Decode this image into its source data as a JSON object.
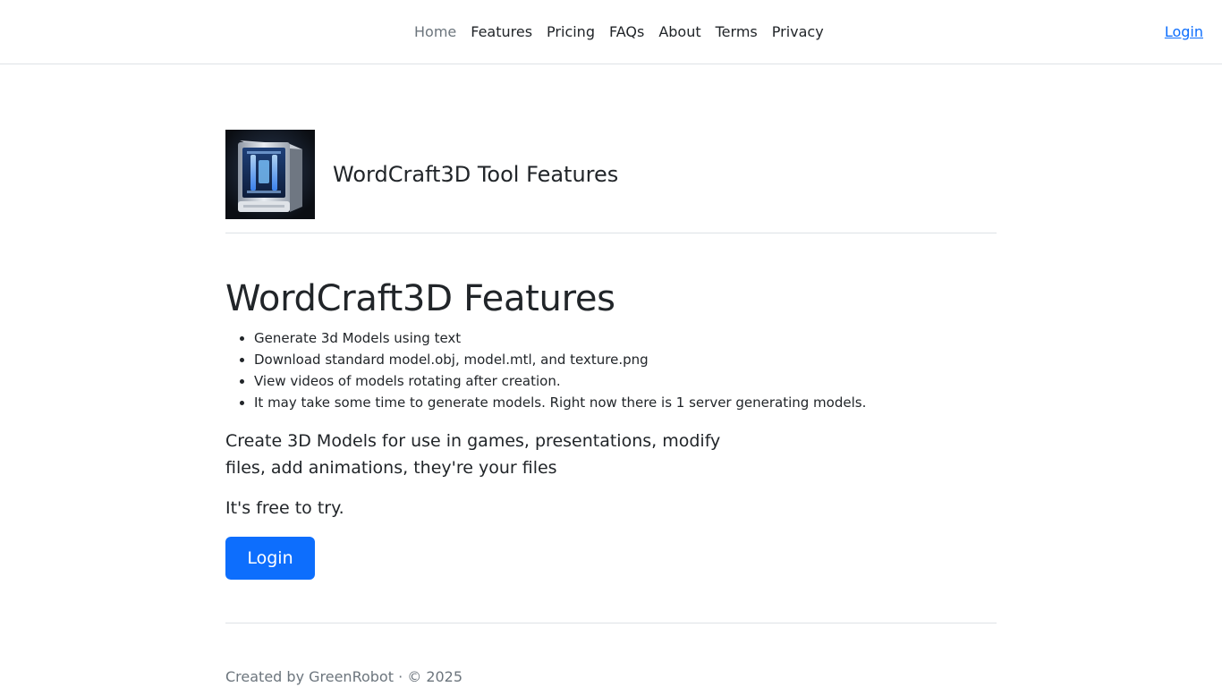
{
  "nav": {
    "links": [
      {
        "label": "Home",
        "active": true
      },
      {
        "label": "Features"
      },
      {
        "label": "Pricing"
      },
      {
        "label": "FAQs"
      },
      {
        "label": "About"
      },
      {
        "label": "Terms"
      },
      {
        "label": "Privacy"
      }
    ],
    "login_label": "Login"
  },
  "header": {
    "logo_icon": "3d-printer-icon",
    "title": "WordCraft3D Tool Features"
  },
  "main": {
    "title": "WordCraft3D Features",
    "features": [
      "Generate 3d Models using text",
      "Download standard model.obj, model.mtl, and texture.png",
      "View videos of models rotating after creation.",
      "It may take some time to generate models. Right now there is 1 server generating models."
    ],
    "lead": "Create 3D Models for use in games, presentations, modify files, add animations, they're your files",
    "free_text": "It's free to try.",
    "cta_label": "Login"
  },
  "footer": {
    "text": "Created by GreenRobot · © 2025"
  },
  "colors": {
    "primary": "#0d6efd",
    "text": "#212529",
    "muted": "#6c757d",
    "border": "#dee2e6"
  }
}
